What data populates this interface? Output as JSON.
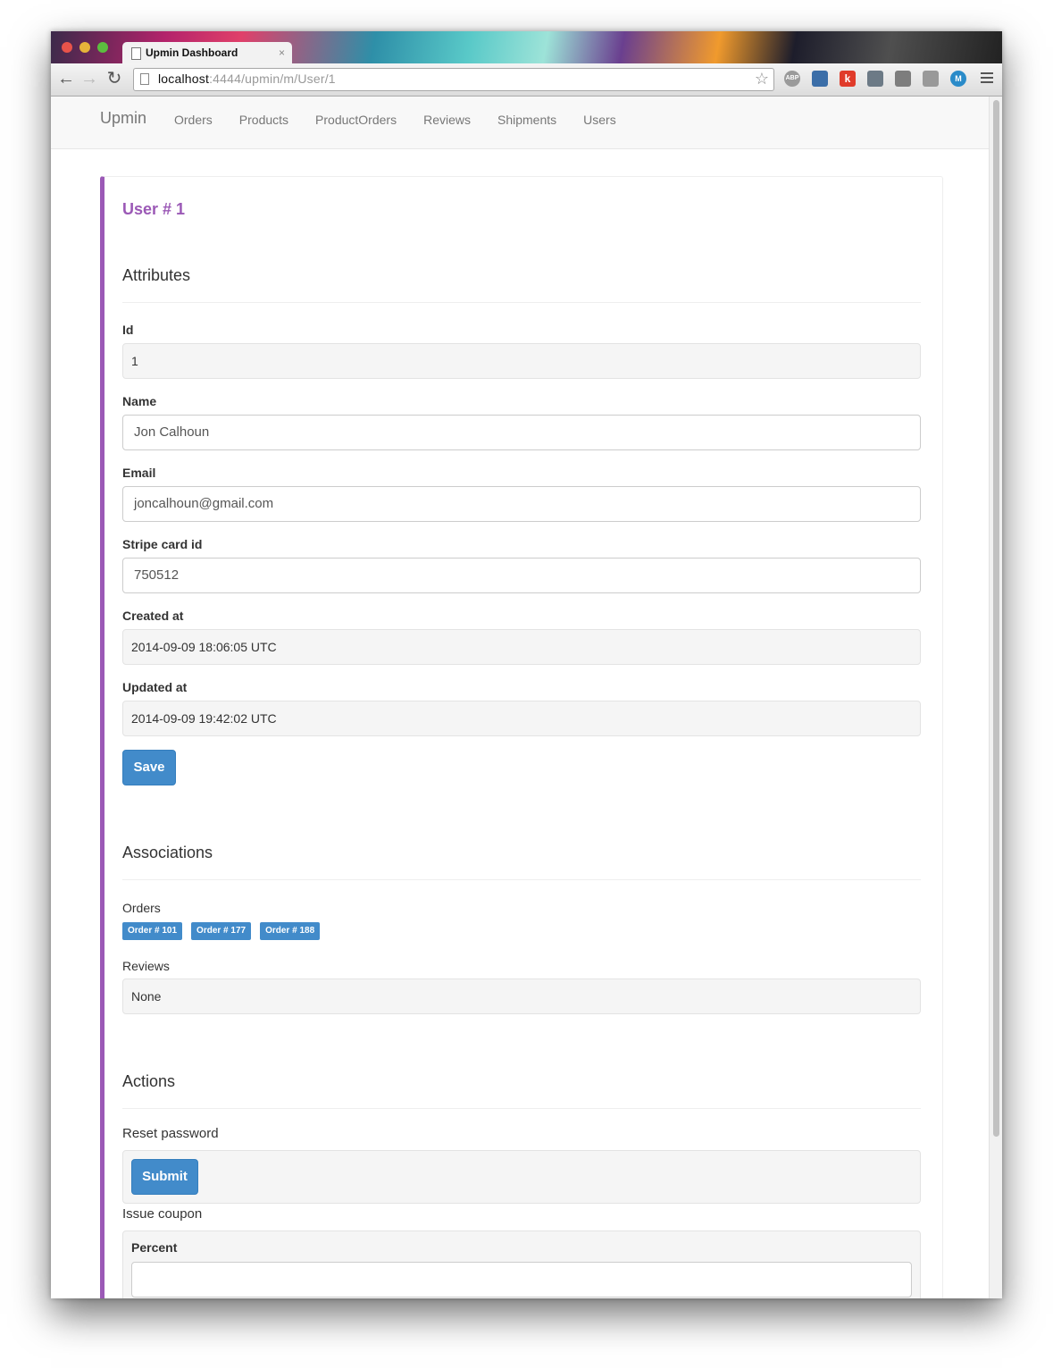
{
  "browser": {
    "tab_title": "Upmin Dashboard",
    "tab_close": "×",
    "url_host": "localhost",
    "url_path": ":4444/upmin/m/User/1",
    "extensions": {
      "abp": "ABP",
      "k": "k",
      "m": "M"
    }
  },
  "nav": {
    "brand": "Upmin",
    "links": [
      "Orders",
      "Products",
      "ProductOrders",
      "Reviews",
      "Shipments",
      "Users"
    ]
  },
  "record": {
    "title": "User # 1",
    "attributes_heading": "Attributes",
    "fields": {
      "id_label": "Id",
      "id_value": "1",
      "name_label": "Name",
      "name_value": "Jon Calhoun",
      "email_label": "Email",
      "email_value": "joncalhoun@gmail.com",
      "stripe_label": "Stripe card id",
      "stripe_value": "750512",
      "created_label": "Created at",
      "created_value": "2014-09-09 18:06:05 UTC",
      "updated_label": "Updated at",
      "updated_value": "2014-09-09 19:42:02 UTC"
    },
    "save_label": "Save",
    "associations_heading": "Associations",
    "orders_label": "Orders",
    "orders": [
      "Order # 101",
      "Order # 177",
      "Order # 188"
    ],
    "reviews_label": "Reviews",
    "reviews_value": "None",
    "actions_heading": "Actions",
    "reset_password_label": "Reset password",
    "submit_label": "Submit",
    "issue_coupon_label": "Issue coupon",
    "percent_label": "Percent",
    "percent_value": ""
  },
  "colors": {
    "accent": "#9b59b6",
    "primary": "#428bca"
  }
}
